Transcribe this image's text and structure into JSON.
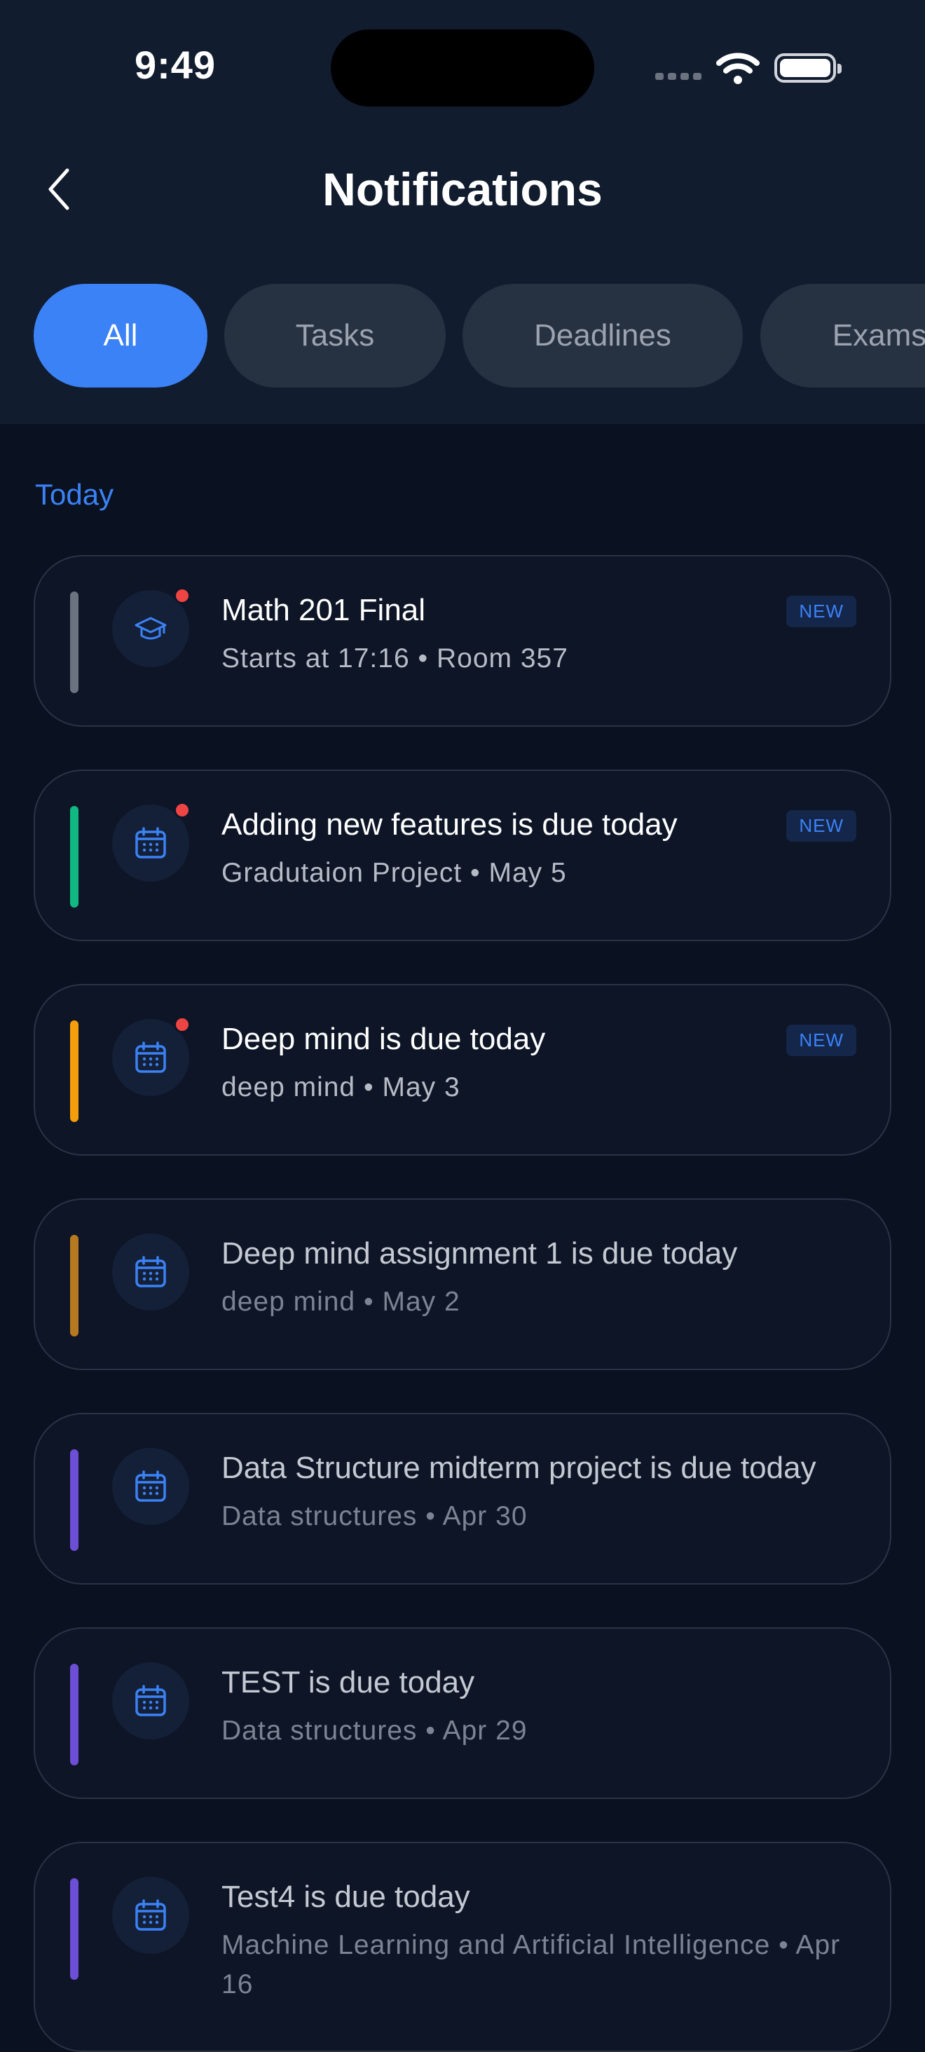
{
  "status_bar": {
    "time": "9:49"
  },
  "header": {
    "title": "Notifications"
  },
  "filters": [
    {
      "label": "All",
      "active": true
    },
    {
      "label": "Tasks",
      "active": false
    },
    {
      "label": "Deadlines",
      "active": false
    },
    {
      "label": "Exams",
      "active": false
    }
  ],
  "section": {
    "label": "Today"
  },
  "notifications": [
    {
      "title": "Math 201 Final",
      "subtitle": "Starts at 17:16 • Room 357",
      "badge": "NEW",
      "accent": "#6b7280",
      "icon": "graduation-cap-icon",
      "unread": true
    },
    {
      "title": "Adding new features is due today",
      "subtitle": "Gradutaion Project • May 5",
      "badge": "NEW",
      "accent": "#10b981",
      "icon": "calendar-icon",
      "unread": true
    },
    {
      "title": "Deep mind is due today",
      "subtitle": "deep mind • May 3",
      "badge": "NEW",
      "accent": "#f59e0b",
      "icon": "calendar-icon",
      "unread": true
    },
    {
      "title": "Deep mind assignment 1 is due today",
      "subtitle": "deep mind • May 2",
      "accent": "#b7791f",
      "icon": "calendar-icon",
      "unread": false
    },
    {
      "title": "Data Structure midterm project is due today",
      "subtitle": "Data structures • Apr 30",
      "accent": "#6d4ed6",
      "icon": "calendar-icon",
      "unread": false
    },
    {
      "title": "TEST is due today",
      "subtitle": "Data structures • Apr 29",
      "accent": "#6d4ed6",
      "icon": "calendar-icon",
      "unread": false
    },
    {
      "title": "Test4 is due today",
      "subtitle": "Machine Learning and Artificial Intelligence • Apr 16",
      "accent": "#6d4ed6",
      "icon": "calendar-icon",
      "unread": false
    }
  ]
}
